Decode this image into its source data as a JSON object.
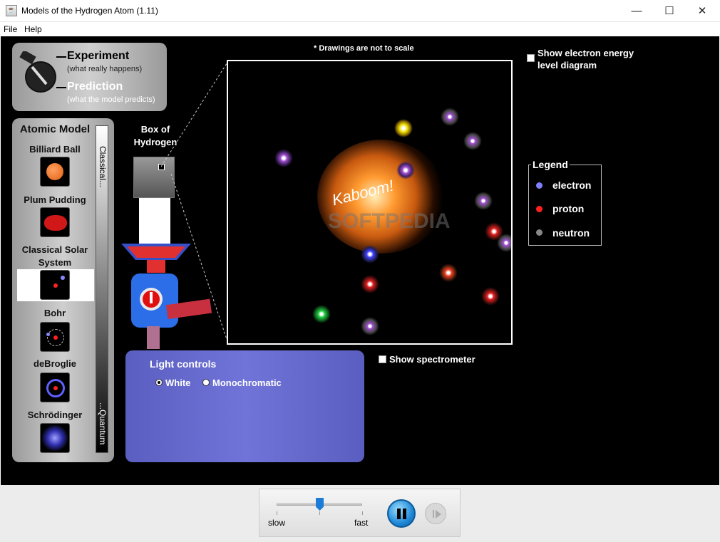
{
  "window": {
    "title": "Models of the Hydrogen Atom (1.11)",
    "icon": "java-icon"
  },
  "menu": {
    "file": "File",
    "help": "Help"
  },
  "mode": {
    "experiment": "Experiment",
    "experiment_sub": "(what really happens)",
    "prediction": "Prediction",
    "prediction_sub": "(what the model predicts)"
  },
  "atomic_model": {
    "title": "Atomic Model",
    "scale_top": "Classical...",
    "scale_bottom": "...Quantum",
    "items": [
      {
        "label": "Billiard Ball"
      },
      {
        "label": "Plum Pudding"
      },
      {
        "label": "Classical Solar System",
        "selected": true
      },
      {
        "label": "Bohr"
      },
      {
        "label": "deBroglie"
      },
      {
        "label": "Schrödinger"
      }
    ]
  },
  "box": {
    "label": "Box of Hydrogen"
  },
  "view": {
    "note": "* Drawings are not to scale",
    "kaboom": "Kaboom!",
    "watermark": "SOFTPEDIA"
  },
  "options": {
    "energy_diagram": "Show electron energy level diagram",
    "spectrometer": "Show spectrometer"
  },
  "legend": {
    "title": "Legend",
    "electron": "electron",
    "proton": "proton",
    "neutron": "neutron",
    "colors": {
      "electron": "#8080ff",
      "proton": "#ff2020",
      "neutron": "#888888"
    }
  },
  "light": {
    "title": "Light controls",
    "white": "White",
    "mono": "Monochromatic",
    "selected": "White"
  },
  "speed": {
    "slow": "slow",
    "fast": "fast",
    "value": 0.5
  },
  "controls": {
    "pause": "pause-icon",
    "step": "step-icon"
  }
}
